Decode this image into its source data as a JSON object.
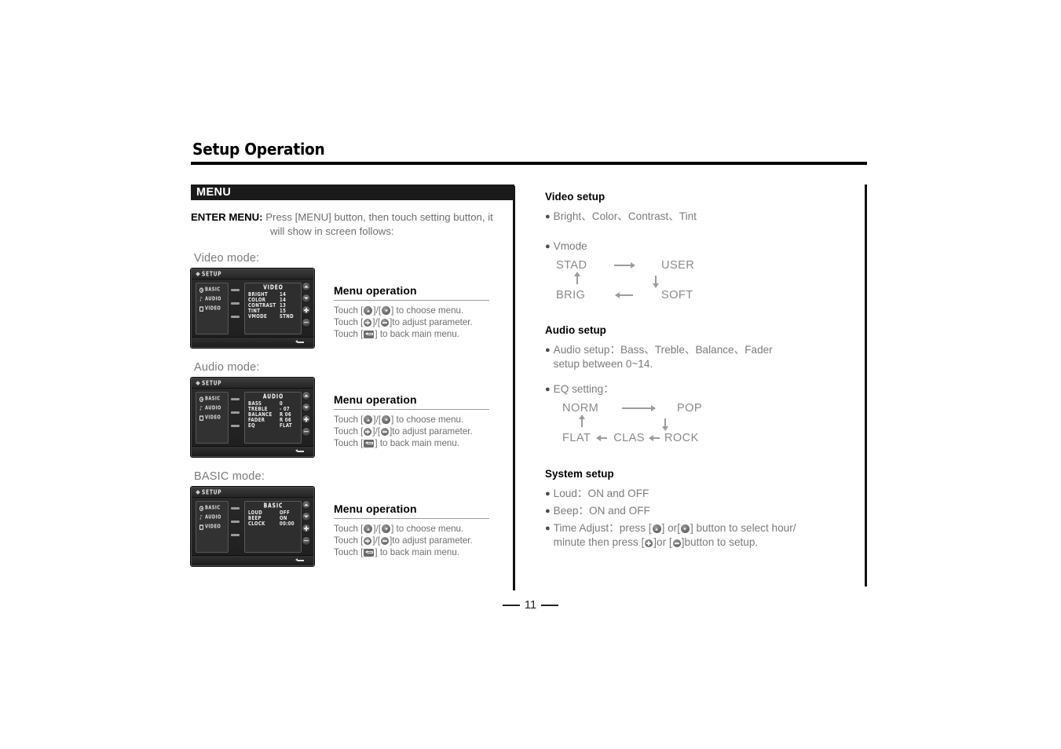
{
  "page": {
    "title": "Setup Operation",
    "number": "11"
  },
  "left": {
    "menu_bar_label": "MENU",
    "enter_menu": {
      "label": "ENTER MENU:",
      "line1": "Press [MENU] button, then touch setting button, it",
      "line2": "will show in screen follows:"
    },
    "blocks": [
      {
        "mode_label": "Video mode:",
        "device": {
          "header": "SETUP",
          "nav": [
            {
              "icon": "gear-icon",
              "label": "BASIC"
            },
            {
              "icon": "music-note-icon",
              "label": "AUDIO"
            },
            {
              "icon": "monitor-icon",
              "label": "VIDEO"
            }
          ],
          "panel_title": "VIDEO",
          "rows": [
            {
              "name": "BRIGHT",
              "value": "14"
            },
            {
              "name": "COLOR",
              "value": "14"
            },
            {
              "name": "CONTRAST",
              "value": "13"
            },
            {
              "name": "TINT",
              "value": "15"
            },
            {
              "name": "VMODE",
              "value": "STND"
            }
          ],
          "buttons": [
            "up-arrow-icon",
            "down-arrow-icon",
            "plus-icon",
            "minus-icon"
          ],
          "back_icon": "back-arrow-icon"
        },
        "menu_operation": {
          "heading": "Menu operation",
          "l1a": "Touch [",
          "l1b": "]/[",
          "l1c": "] to choose menu.",
          "l2a": "Touch [",
          "l2b": "]/[",
          "l2c": "]to adjust parameter.",
          "l3a": "Touch [",
          "l3b": "] to back main menu."
        }
      },
      {
        "mode_label": "Audio mode:",
        "device": {
          "header": "SETUP",
          "nav": [
            {
              "icon": "gear-icon",
              "label": "BASIC"
            },
            {
              "icon": "music-note-icon",
              "label": "AUDIO"
            },
            {
              "icon": "monitor-icon",
              "label": "VIDEO"
            }
          ],
          "panel_title": "AUDIO",
          "rows": [
            {
              "name": "BASS",
              "value": "0"
            },
            {
              "name": "TREBLE",
              "value": "-  07"
            },
            {
              "name": "BALANCE",
              "value": "R 06"
            },
            {
              "name": "FADER",
              "value": "R 06"
            },
            {
              "name": "EQ",
              "value": "FLAT"
            }
          ],
          "buttons": [
            "up-arrow-icon",
            "down-arrow-icon",
            "plus-icon",
            "minus-icon"
          ],
          "back_icon": "back-arrow-icon"
        },
        "menu_operation": {
          "heading": "Menu operation",
          "l1a": "Touch [",
          "l1b": "]/[",
          "l1c": "] to choose menu.",
          "l2a": "Touch [",
          "l2b": "]/[",
          "l2c": "]to adjust parameter.",
          "l3a": "Touch [",
          "l3b": "] to back main menu."
        }
      },
      {
        "mode_label": "BASIC mode:",
        "device": {
          "header": "SETUP",
          "nav": [
            {
              "icon": "gear-icon",
              "label": "BASIC"
            },
            {
              "icon": "music-note-icon",
              "label": "AUDIO"
            },
            {
              "icon": "monitor-icon",
              "label": "VIDEO"
            }
          ],
          "panel_title": "BASIC",
          "rows": [
            {
              "name": "LOUD",
              "value": "OFF"
            },
            {
              "name": "BEEP",
              "value": "ON"
            },
            {
              "name": "CLOCK",
              "value": "00:00"
            }
          ],
          "buttons": [
            "up-arrow-icon",
            "down-arrow-icon",
            "plus-icon",
            "minus-icon"
          ],
          "back_icon": "back-arrow-icon"
        },
        "menu_operation": {
          "heading": "Menu operation",
          "l1a": "Touch [",
          "l1b": "]/[",
          "l1c": "] to choose menu.",
          "l2a": "Touch [",
          "l2b": "]/[",
          "l2c": "]to adjust parameter.",
          "l3a": "Touch [",
          "l3b": "] to back main menu."
        }
      }
    ]
  },
  "right": {
    "video_setup": {
      "heading": "Video setup",
      "bullet1": "Bright、Color、Contrast、Tint",
      "bullet2": "Vmode",
      "cycle": {
        "top_left": "STAD",
        "top_right": "USER",
        "bottom_left": "BRIG",
        "bottom_right": "SOFT"
      }
    },
    "audio_setup": {
      "heading": "Audio setup",
      "bullet1_line1": "Audio setup：Bass、Treble、Balance、Fader",
      "bullet1_line2": "setup between 0~14.",
      "bullet2": "EQ setting：",
      "cycle": {
        "top_left": "NORM",
        "top_right": "POP",
        "bottom_left": "FLAT",
        "bottom_mid": "CLAS",
        "bottom_right": "ROCK"
      }
    },
    "system_setup": {
      "heading": "System setup",
      "bullet1": "Loud：ON and OFF",
      "bullet2": "Beep：ON and OFF",
      "bullet3_a": "Time Adjust：press [",
      "bullet3_b": "] or[",
      "bullet3_c": "] button to select hour/",
      "bullet3_d": "minute then press [",
      "bullet3_e": "]or [",
      "bullet3_f": "]button to setup."
    }
  }
}
